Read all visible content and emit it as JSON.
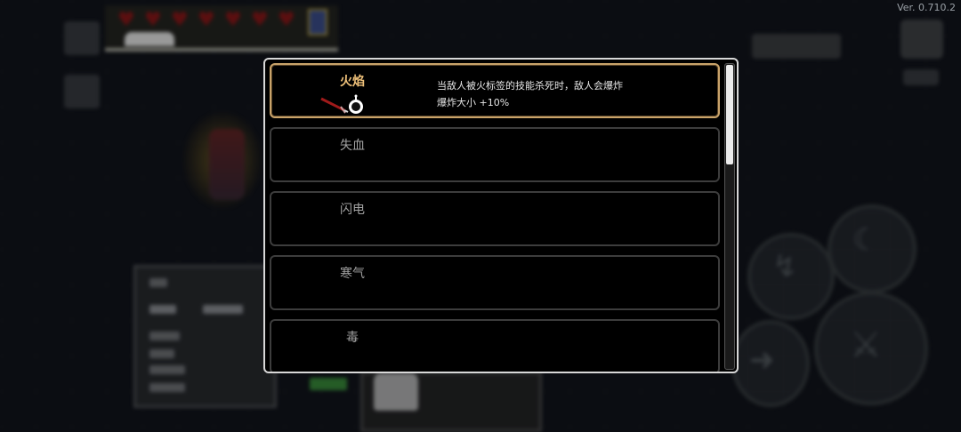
{
  "version": "Ver. 0.710.2",
  "modal": {
    "items": [
      {
        "title": "火焰",
        "selected": true,
        "desc": [
          "当敌人被火标签的技能杀死时，敌人会爆炸",
          "爆炸大小 +10%"
        ],
        "icons": [
          "sword-icon",
          "bomb-icon"
        ]
      },
      {
        "title": "失血",
        "selected": false
      },
      {
        "title": "闪电",
        "selected": false
      },
      {
        "title": "寒气",
        "selected": false
      },
      {
        "title": "毒",
        "selected": false
      }
    ]
  },
  "colors": {
    "selected_border": "#c9a36a",
    "selected_title": "#f0c27a",
    "card_border": "#3d3d3d"
  }
}
